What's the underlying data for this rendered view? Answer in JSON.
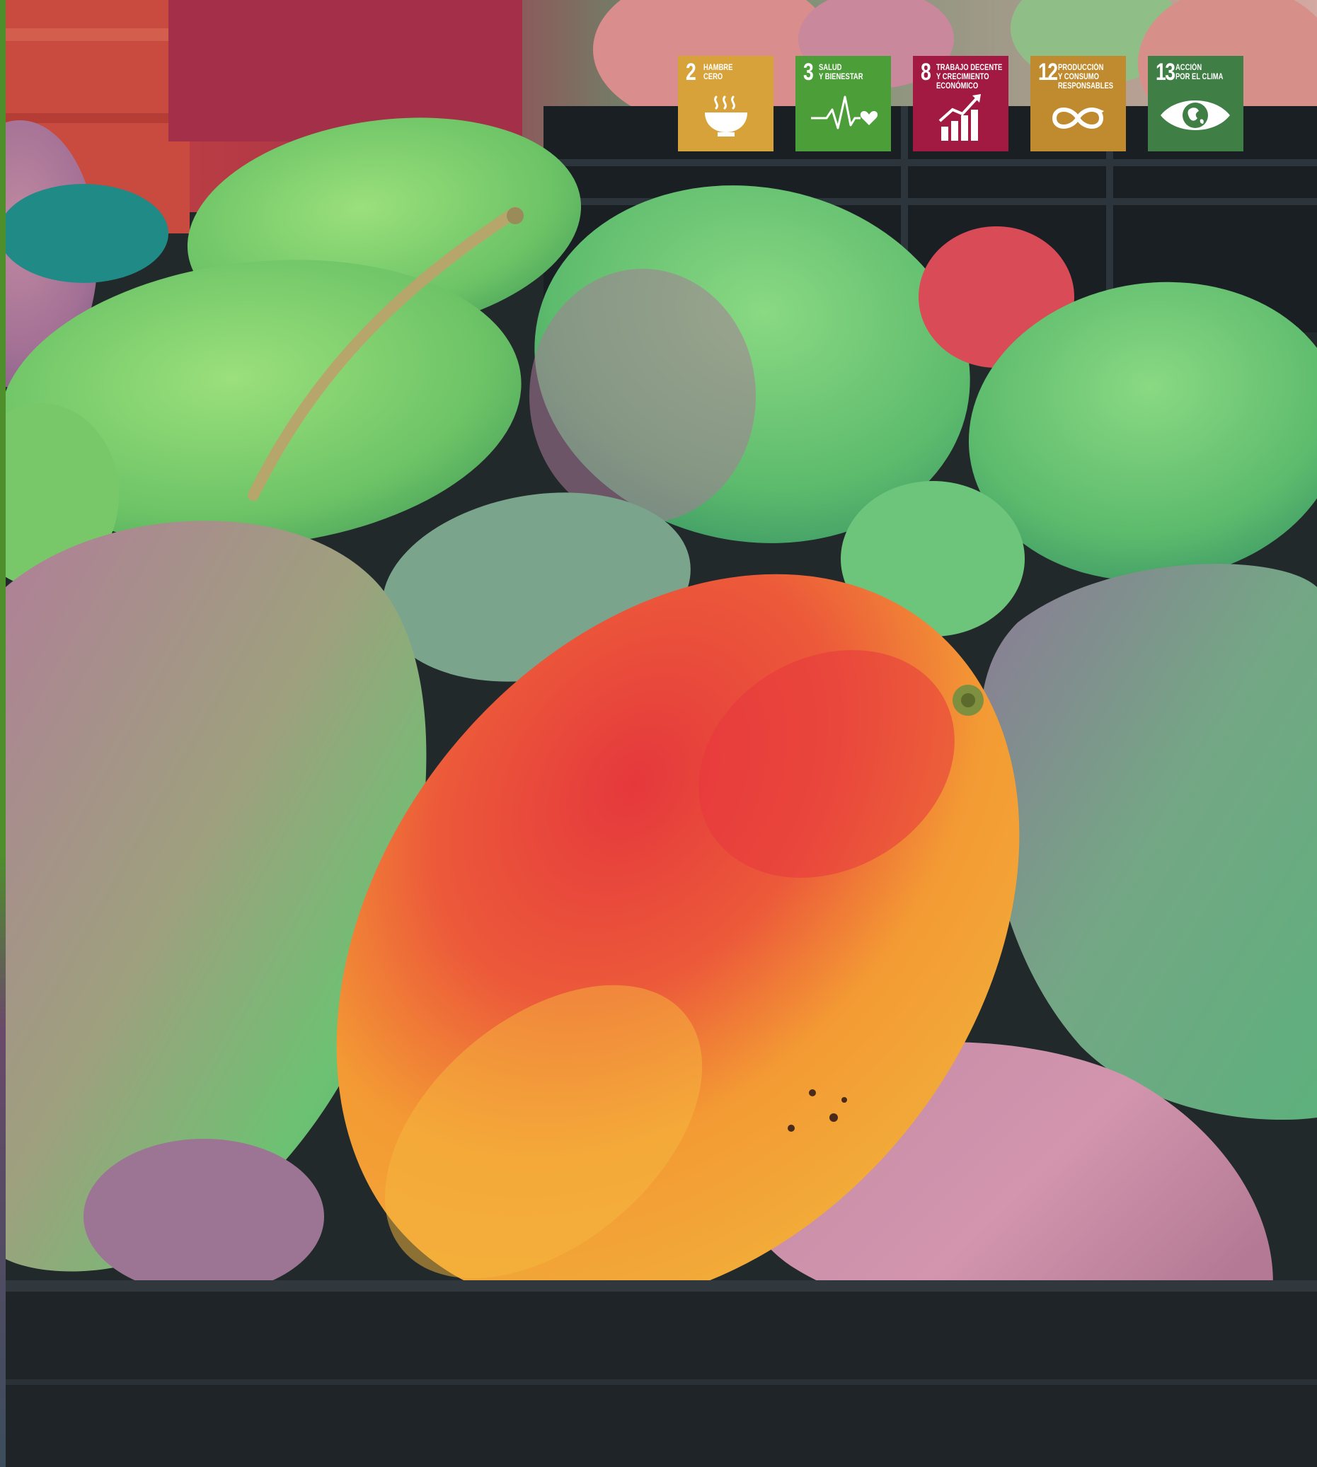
{
  "photo": {
    "subject": "mangoes",
    "colors": {
      "mango_red": "#e23b3b",
      "mango_orange": "#f2a230",
      "mango_green": "#6fc36a",
      "crate_black": "#1d2124"
    }
  },
  "sdg_badges": [
    {
      "number": "2",
      "label": "HAMBRE\nCERO",
      "icon": "bowl-icon",
      "color": "#d6a239"
    },
    {
      "number": "3",
      "label": "SALUD\nY BIENESTAR",
      "icon": "heartbeat-icon",
      "color": "#4c9f38"
    },
    {
      "number": "8",
      "label": "TRABAJO DECENTE\nY CRECIMIENTO\nECONÓMICO",
      "icon": "growth-chart-icon",
      "color": "#a21942"
    },
    {
      "number": "12",
      "label": "PRODUCCIÓN\nY CONSUMO\nRESPONSABLES",
      "icon": "infinity-icon",
      "color": "#bf8b2e"
    },
    {
      "number": "13",
      "label": "ACCIÓN\nPOR EL CLIMA",
      "icon": "eye-globe-icon",
      "color": "#3f7e44"
    }
  ]
}
